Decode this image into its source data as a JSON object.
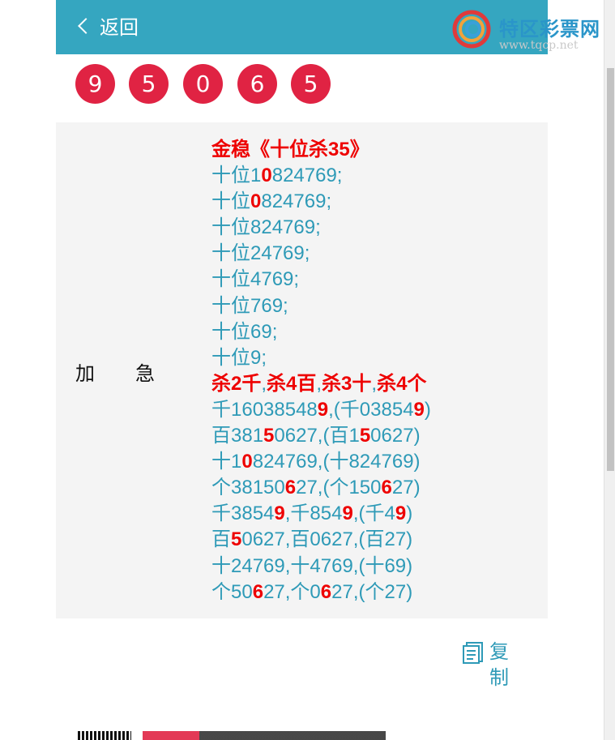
{
  "header": {
    "back_label": "返回",
    "brand_title": "特区彩票网",
    "brand_url": "www.tqcp.net",
    "bg_color": "#35a6c0"
  },
  "balls": [
    "9",
    "5",
    "0",
    "6",
    "5"
  ],
  "ball_color": "#e02343",
  "panel": {
    "label_1": "加",
    "label_2": "急",
    "lines": [
      {
        "title": true,
        "parts": [
          {
            "t": "金稳《十位杀35》",
            "r": true
          }
        ]
      },
      {
        "parts": [
          {
            "t": "十位1"
          },
          {
            "t": "0",
            "r": true
          },
          {
            "t": "824769;"
          }
        ]
      },
      {
        "parts": [
          {
            "t": "十位"
          },
          {
            "t": "0",
            "r": true
          },
          {
            "t": "824769;"
          }
        ]
      },
      {
        "parts": [
          {
            "t": "十位824769;"
          }
        ]
      },
      {
        "parts": [
          {
            "t": "十位24769;"
          }
        ]
      },
      {
        "parts": [
          {
            "t": "十位4769;"
          }
        ]
      },
      {
        "parts": [
          {
            "t": "十位769;"
          }
        ]
      },
      {
        "parts": [
          {
            "t": "十位69;"
          }
        ]
      },
      {
        "parts": [
          {
            "t": "十位9;"
          }
        ]
      },
      {
        "parts": [
          {
            "t": "杀2千",
            "r": true
          },
          {
            "t": ","
          },
          {
            "t": "杀4百",
            "r": true
          },
          {
            "t": ","
          },
          {
            "t": "杀3十",
            "r": true
          },
          {
            "t": ","
          },
          {
            "t": "杀4个",
            "r": true
          }
        ]
      },
      {
        "parts": [
          {
            "t": "千16038548"
          },
          {
            "t": "9",
            "r": true
          },
          {
            "t": ",(千03854"
          },
          {
            "t": "9",
            "r": true
          },
          {
            "t": ")"
          }
        ]
      },
      {
        "parts": [
          {
            "t": "百381"
          },
          {
            "t": "5",
            "r": true
          },
          {
            "t": "0627,(百1"
          },
          {
            "t": "5",
            "r": true
          },
          {
            "t": "0627)"
          }
        ]
      },
      {
        "parts": [
          {
            "t": "十1"
          },
          {
            "t": "0",
            "r": true
          },
          {
            "t": "824769,(十824769)"
          }
        ]
      },
      {
        "parts": [
          {
            "t": "个38150"
          },
          {
            "t": "6",
            "r": true
          },
          {
            "t": "27,(个150"
          },
          {
            "t": "6",
            "r": true
          },
          {
            "t": "27)"
          }
        ]
      },
      {
        "parts": [
          {
            "t": "千3854"
          },
          {
            "t": "9",
            "r": true
          },
          {
            "t": ",千854"
          },
          {
            "t": "9",
            "r": true
          },
          {
            "t": ",(千4"
          },
          {
            "t": "9",
            "r": true
          },
          {
            "t": ")"
          }
        ]
      },
      {
        "parts": [
          {
            "t": "百"
          },
          {
            "t": "5",
            "r": true
          },
          {
            "t": "0627,百0627,(百27)"
          }
        ]
      },
      {
        "parts": [
          {
            "t": "十24769,十4769,(十69)"
          }
        ]
      },
      {
        "parts": [
          {
            "t": "个50"
          },
          {
            "t": "6",
            "r": true
          },
          {
            "t": "27,个0"
          },
          {
            "t": "6",
            "r": true
          },
          {
            "t": "27,(个27)"
          }
        ]
      }
    ]
  },
  "copy": {
    "label": "复制",
    "icon": "copy-icon"
  },
  "colors": {
    "text_blue": "#2e9ab7",
    "highlight_red": "#ee0000"
  }
}
